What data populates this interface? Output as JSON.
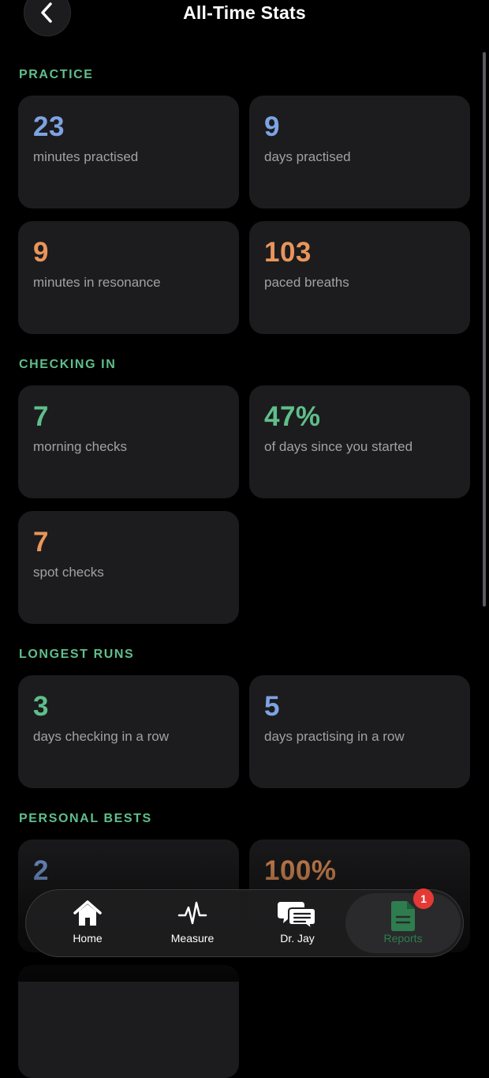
{
  "header": {
    "title": "All-Time Stats"
  },
  "colors": {
    "section": "#5fbf8a",
    "blue": "#7ea3e3",
    "orange": "#e9955b",
    "green": "#5fbf8a"
  },
  "sections": {
    "practice": {
      "title": "PRACTICE",
      "cards": [
        {
          "value": "23",
          "label": "minutes practised",
          "color": "blue"
        },
        {
          "value": "9",
          "label": "days practised",
          "color": "blue"
        },
        {
          "value": "9",
          "label": "minutes in resonance",
          "color": "orange"
        },
        {
          "value": "103",
          "label": "paced breaths",
          "color": "orange"
        }
      ]
    },
    "checking_in": {
      "title": "CHECKING IN",
      "cards": [
        {
          "value": "7",
          "label": "morning checks",
          "color": "green"
        },
        {
          "value": "47%",
          "label": "of days since you started",
          "color": "green"
        },
        {
          "value": "7",
          "label": "spot checks",
          "color": "orange"
        }
      ]
    },
    "longest_runs": {
      "title": "LONGEST RUNS",
      "cards": [
        {
          "value": "3",
          "label": "days checking in a row",
          "color": "green"
        },
        {
          "value": "5",
          "label": "days practising in a row",
          "color": "blue"
        }
      ]
    },
    "personal_bests": {
      "title": "PERSONAL BESTS",
      "cards": [
        {
          "value": "2",
          "label": "",
          "color": "blue"
        },
        {
          "value": "100%",
          "label": "",
          "color": "orange"
        }
      ]
    }
  },
  "tabbar": {
    "tabs": [
      {
        "label": "Home",
        "icon": "home-icon"
      },
      {
        "label": "Measure",
        "icon": "pulse-icon"
      },
      {
        "label": "Dr. Jay",
        "icon": "chat-icon"
      },
      {
        "label": "Reports",
        "icon": "report-icon",
        "badge": "1",
        "active": true
      }
    ]
  }
}
